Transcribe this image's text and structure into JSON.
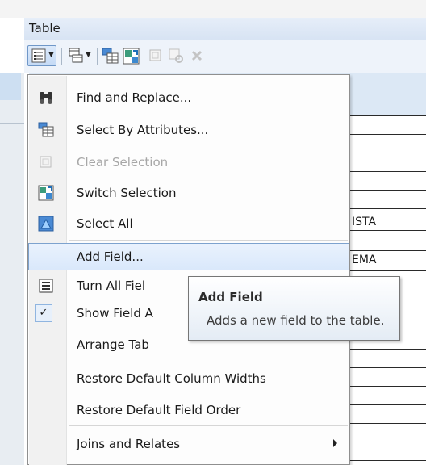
{
  "window": {
    "title": "Table"
  },
  "toolbar": {
    "icons": [
      "table-options-icon",
      "related-tables-icon",
      "select-by-attributes-icon",
      "switch-selection-icon",
      "clear-selection-icon",
      "zoom-to-selected-icon",
      "delete-selected-icon"
    ]
  },
  "table": {
    "cells": [
      "ISTA",
      "EMA"
    ]
  },
  "menu": {
    "items": [
      {
        "label": "Find and Replace...",
        "icon": "binoculars-icon"
      },
      {
        "label": "Select By Attributes...",
        "icon": "select-by-attributes-icon"
      },
      {
        "label": "Clear Selection",
        "icon": "clear-selection-icon",
        "disabled": true
      },
      {
        "label": "Switch Selection",
        "icon": "switch-selection-icon"
      },
      {
        "label": "Select All",
        "icon": "select-all-icon"
      },
      {
        "label": "Add Field...",
        "highlighted": true
      },
      {
        "label": "Turn All Fiel",
        "icon": "field-list-icon"
      },
      {
        "label": "Show Field A",
        "icon": "check-icon",
        "checked": true
      },
      {
        "label": "Arrange Tab"
      },
      {
        "label": "Restore Default Column Widths"
      },
      {
        "label": "Restore Default Field Order"
      },
      {
        "label": "Joins and Relates",
        "submenu": true
      }
    ]
  },
  "tooltip": {
    "title": "Add Field",
    "description": "Adds a new field to the table."
  },
  "colors": {
    "highlight": "#d9e8fb",
    "highlight_border": "#7da2ce",
    "disabled_text": "#a7a7a7"
  }
}
